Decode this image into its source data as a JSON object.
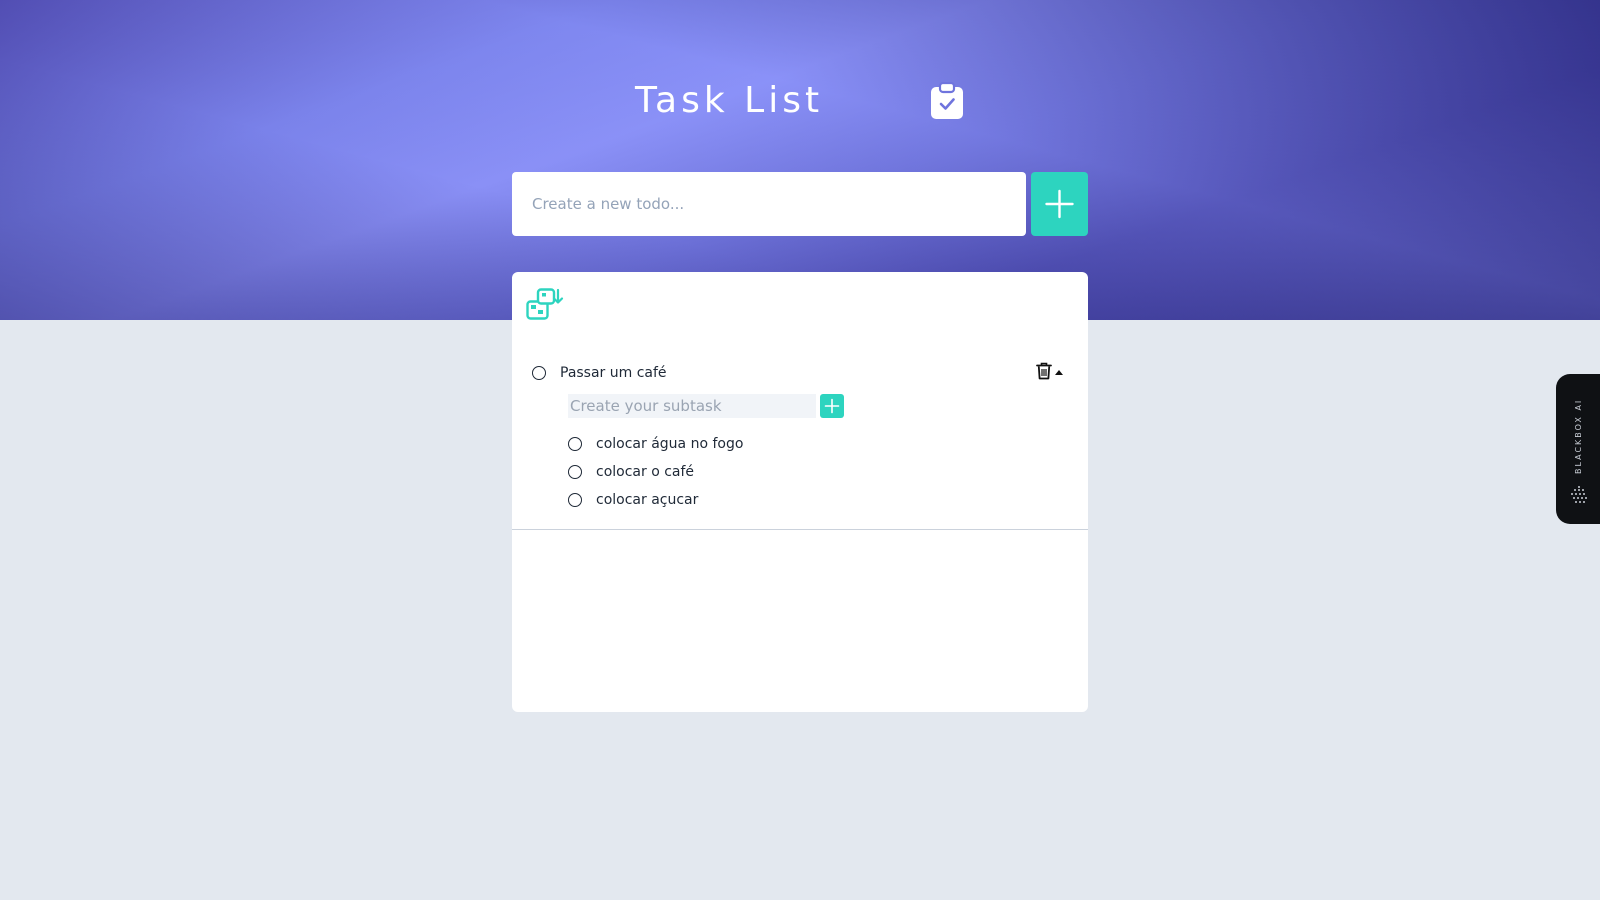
{
  "header": {
    "title": "Task List",
    "icon": "clipboard-check-icon"
  },
  "new_todo": {
    "placeholder": "Create a new todo...",
    "add_icon": "plus-icon"
  },
  "card": {
    "toolbar_icon": "swap-items-icon"
  },
  "tasks": [
    {
      "label": "Passar um café",
      "completed": false,
      "expanded": true,
      "subtask_input_placeholder": "Create your subtask",
      "subtasks": [
        {
          "label": "colocar água no fogo",
          "completed": false
        },
        {
          "label": "colocar o café",
          "completed": false
        },
        {
          "label": "colocar açucar",
          "completed": false
        }
      ]
    }
  ],
  "side_widget": {
    "label": "BLACKBOX AI"
  },
  "colors": {
    "accent": "#2dd4bf",
    "background": "#e3e8ef",
    "hero_gradient_light": "#8a90f6",
    "hero_gradient_dark": "#2d2a7c"
  }
}
